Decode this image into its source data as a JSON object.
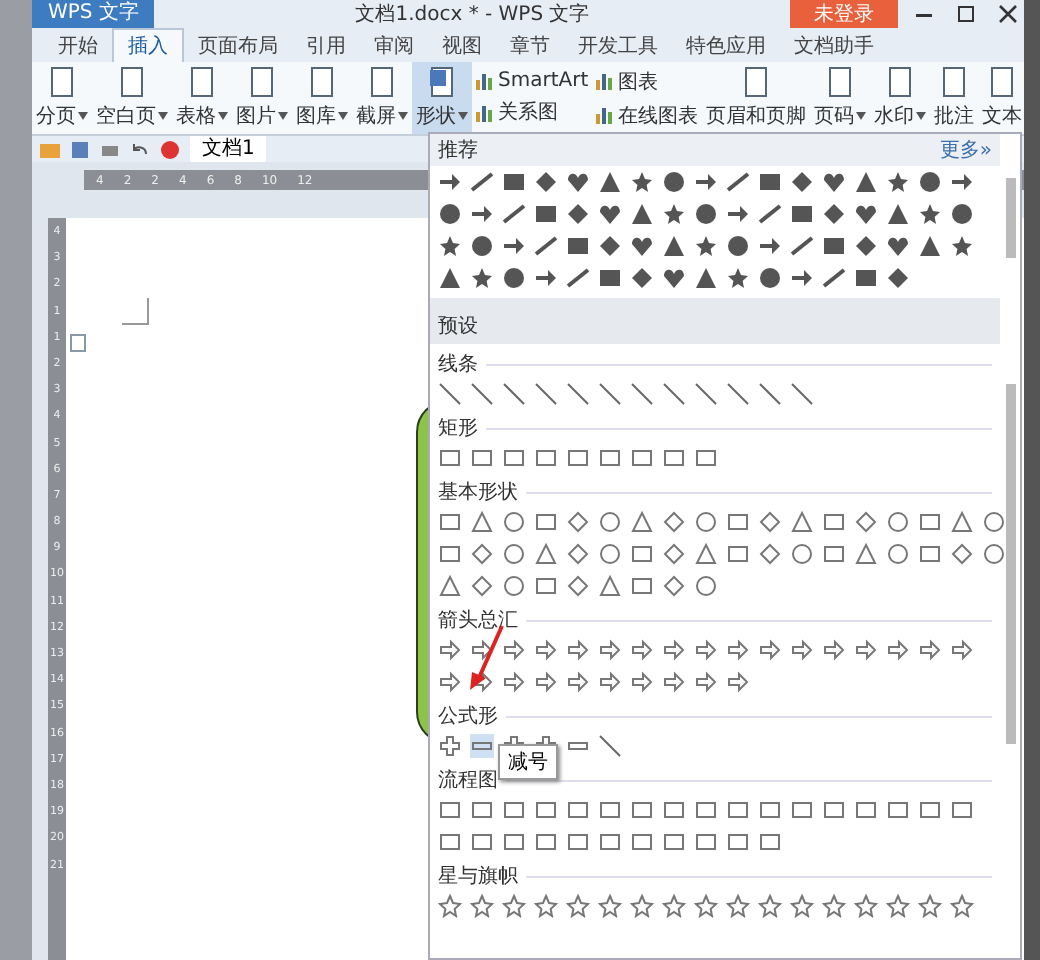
{
  "window": {
    "app_badge": "WPS 文字",
    "title": "文档1.docx * - WPS 文字",
    "login_button": "未登录"
  },
  "tabs": [
    {
      "label": "开始",
      "selected": false
    },
    {
      "label": "插入",
      "selected": true
    },
    {
      "label": "页面布局",
      "selected": false
    },
    {
      "label": "引用",
      "selected": false
    },
    {
      "label": "审阅",
      "selected": false
    },
    {
      "label": "视图",
      "selected": false
    },
    {
      "label": "章节",
      "selected": false
    },
    {
      "label": "开发工具",
      "selected": false
    },
    {
      "label": "特色应用",
      "selected": false
    },
    {
      "label": "文档助手",
      "selected": false
    }
  ],
  "ribbon": [
    {
      "kind": "large",
      "label": "分页",
      "dropdown": true,
      "selected": false
    },
    {
      "kind": "large",
      "label": "空白页",
      "dropdown": true,
      "selected": false
    },
    {
      "kind": "large",
      "label": "表格",
      "dropdown": true,
      "selected": false
    },
    {
      "kind": "large",
      "label": "图片",
      "dropdown": true,
      "selected": false
    },
    {
      "kind": "large",
      "label": "图库",
      "dropdown": true,
      "selected": false
    },
    {
      "kind": "large",
      "label": "截屏",
      "dropdown": true,
      "selected": false
    },
    {
      "kind": "large",
      "label": "形状",
      "dropdown": true,
      "selected": true
    },
    {
      "kind": "stack",
      "items": [
        "SmartArt",
        "关系图"
      ]
    },
    {
      "kind": "stack",
      "items": [
        "图表",
        "在线图表"
      ]
    },
    {
      "kind": "large",
      "label": "页眉和页脚",
      "dropdown": false,
      "selected": false
    },
    {
      "kind": "large",
      "label": "页码",
      "dropdown": true,
      "selected": false
    },
    {
      "kind": "large",
      "label": "水印",
      "dropdown": true,
      "selected": false
    },
    {
      "kind": "large",
      "label": "批注",
      "dropdown": false,
      "selected": false
    },
    {
      "kind": "large",
      "label": "文本",
      "dropdown": false,
      "selected": false
    }
  ],
  "doc_tab": "文档1",
  "ruler": {
    "horizontal": [
      "4",
      "2",
      "2",
      "4",
      "6",
      "8",
      "10",
      "12"
    ],
    "vertical": [
      "4",
      "3",
      "2",
      "1",
      "1",
      "2",
      "3",
      "4",
      "5",
      "6",
      "7",
      "8",
      "9",
      "10",
      "11",
      "12",
      "13",
      "14",
      "15",
      "16",
      "17",
      "18",
      "19",
      "20",
      "21"
    ]
  },
  "gallery": {
    "recommended_title": "推荐",
    "more_link": "更多»",
    "presets_title": "预设",
    "sections": [
      {
        "title": "线条"
      },
      {
        "title": "矩形"
      },
      {
        "title": "基本形状"
      },
      {
        "title": "箭头总汇"
      },
      {
        "title": "公式形"
      },
      {
        "title": "流程图"
      },
      {
        "title": "星与旗帜"
      }
    ]
  },
  "tooltip": "减号"
}
